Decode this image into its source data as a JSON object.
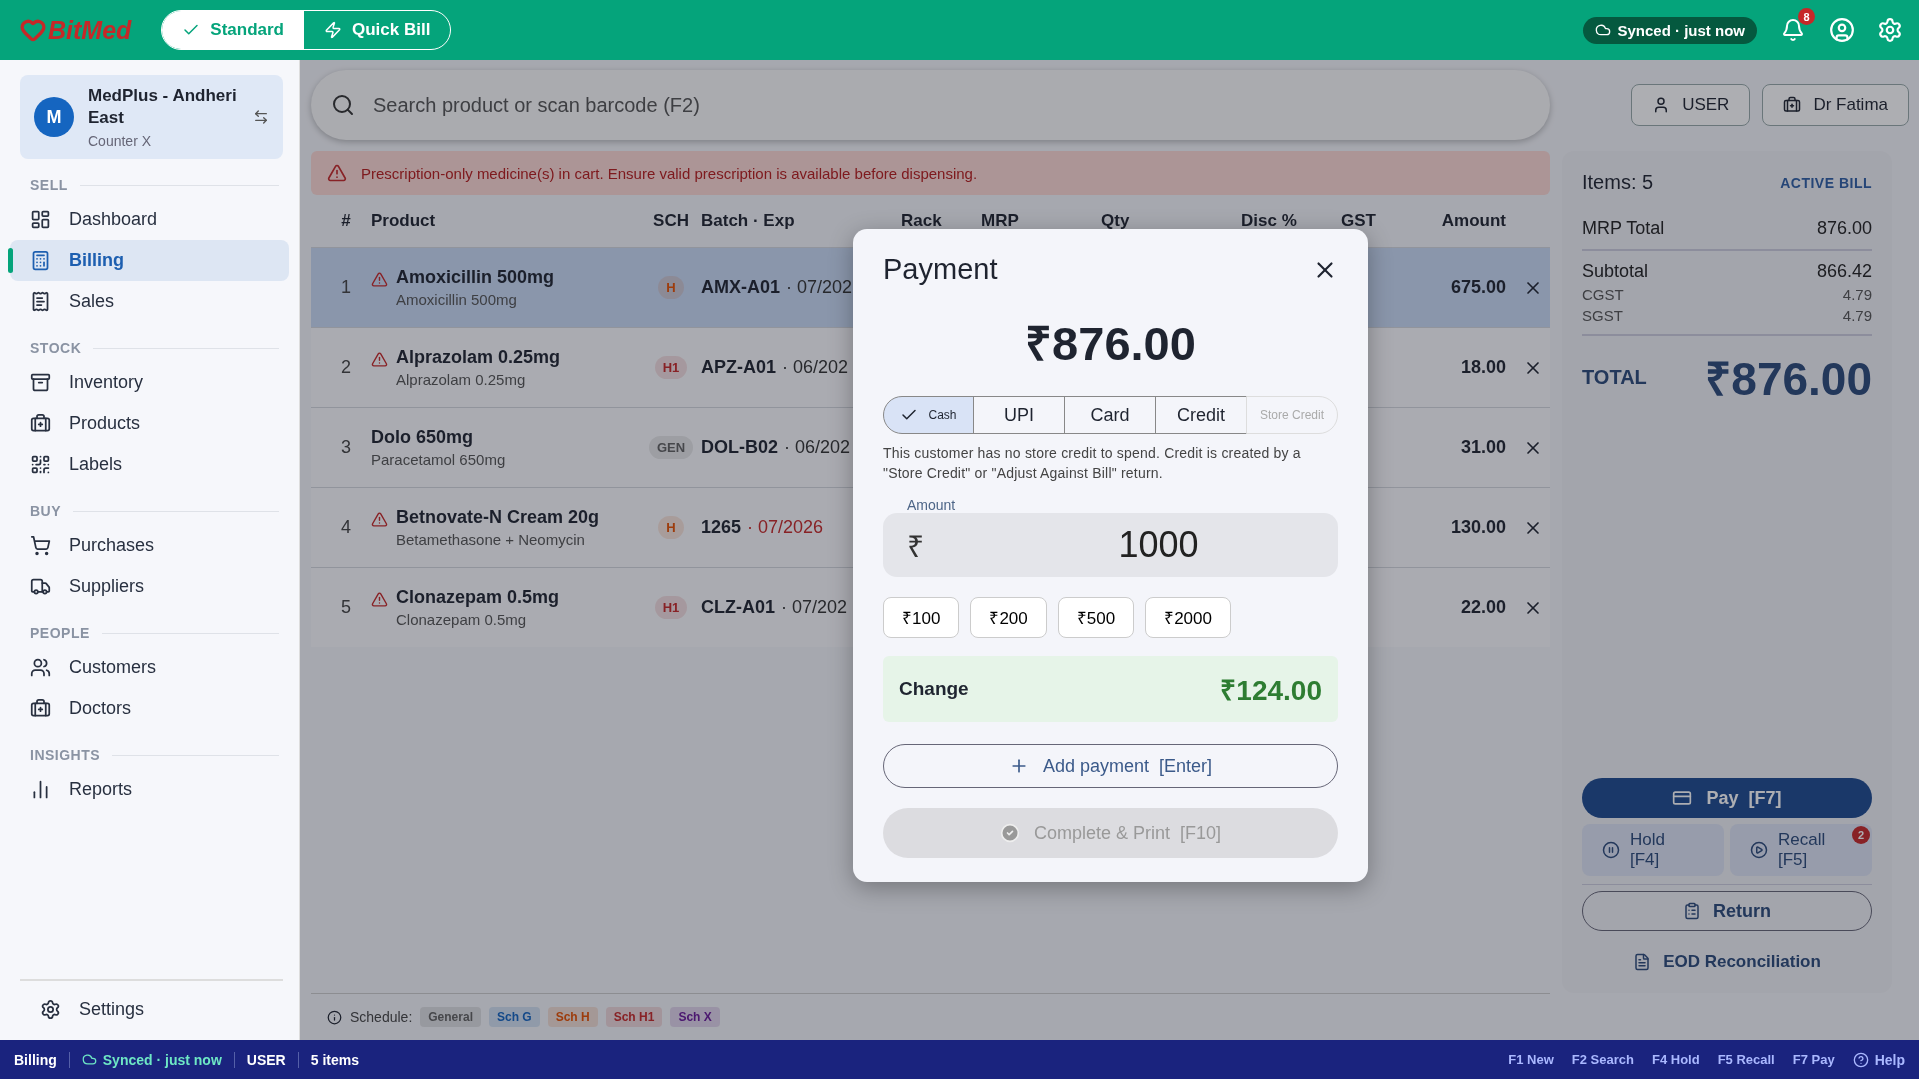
{
  "header": {
    "logo": "BitMed",
    "modes": [
      {
        "label": "Standard",
        "selected": true
      },
      {
        "label": "Quick Bill",
        "selected": false
      }
    ],
    "sync": "Synced · just now",
    "notifications": "8"
  },
  "store": {
    "avatar": "M",
    "name": "MedPlus - Andheri East",
    "counter": "Counter X"
  },
  "sidebar": {
    "sections": [
      {
        "title": "SELL",
        "items": [
          {
            "label": "Dashboard",
            "selected": false
          },
          {
            "label": "Billing",
            "selected": true
          },
          {
            "label": "Sales",
            "selected": false
          }
        ]
      },
      {
        "title": "STOCK",
        "items": [
          {
            "label": "Inventory",
            "selected": false
          },
          {
            "label": "Products",
            "selected": false
          },
          {
            "label": "Labels",
            "selected": false
          }
        ]
      },
      {
        "title": "BUY",
        "items": [
          {
            "label": "Purchases",
            "selected": false
          },
          {
            "label": "Suppliers",
            "selected": false
          }
        ]
      },
      {
        "title": "PEOPLE",
        "items": [
          {
            "label": "Customers",
            "selected": false
          },
          {
            "label": "Doctors",
            "selected": false
          }
        ]
      },
      {
        "title": "INSIGHTS",
        "items": [
          {
            "label": "Reports",
            "selected": false
          }
        ]
      }
    ],
    "footer": "Settings"
  },
  "search": {
    "placeholder": "Search product or scan barcode (F2)"
  },
  "top_buttons": [
    "USER",
    "Dr Fatima"
  ],
  "alert": "Prescription-only medicine(s) in cart. Ensure valid prescription is available before dispensing.",
  "table": {
    "columns": [
      "#",
      "Product",
      "SCH",
      "Batch · Exp",
      "Rack",
      "MRP",
      "Qty",
      "Disc %",
      "GST",
      "Amount"
    ],
    "rows": [
      {
        "index": "1",
        "product": "Amoxicillin 500mg",
        "generic": "Amoxicillin 500mg",
        "warning": true,
        "schedule": {
          "label": "H",
          "kind": "h"
        },
        "batch": "AMX-A01",
        "expiry": "· 07/202",
        "expiry_alert": false,
        "amount": "675.00",
        "selected": true
      },
      {
        "index": "2",
        "product": "Alprazolam 0.25mg",
        "generic": "Alprazolam 0.25mg",
        "warning": true,
        "schedule": {
          "label": "H1",
          "kind": "h1"
        },
        "batch": "APZ-A01",
        "expiry": "· 06/202",
        "expiry_alert": false,
        "amount": "18.00",
        "selected": false
      },
      {
        "index": "3",
        "product": "Dolo 650mg",
        "generic": "Paracetamol 650mg",
        "warning": false,
        "schedule": {
          "label": "GEN",
          "kind": "general"
        },
        "batch": "DOL-B02",
        "expiry": "· 06/202",
        "expiry_alert": false,
        "amount": "31.00",
        "selected": false
      },
      {
        "index": "4",
        "product": "Betnovate-N Cream 20g",
        "generic": "Betamethasone + Neomycin",
        "warning": true,
        "schedule": {
          "label": "H",
          "kind": "h"
        },
        "batch": "1265",
        "expiry": "· 07/2026",
        "expiry_alert": true,
        "amount": "130.00",
        "selected": false
      },
      {
        "index": "5",
        "product": "Clonazepam 0.5mg",
        "generic": "Clonazepam 0.5mg",
        "warning": true,
        "schedule": {
          "label": "H1",
          "kind": "h1"
        },
        "batch": "CLZ-A01",
        "expiry": "· 07/202",
        "expiry_alert": false,
        "amount": "22.00",
        "selected": false
      }
    ]
  },
  "legend": {
    "label": "Schedule:",
    "items": [
      {
        "label": "General",
        "kind": "general"
      },
      {
        "label": "Sch G",
        "kind": "g"
      },
      {
        "label": "Sch H",
        "kind": "h"
      },
      {
        "label": "Sch H1",
        "kind": "h1"
      },
      {
        "label": "Sch X",
        "kind": "x"
      }
    ]
  },
  "summary": {
    "items": "Items: 5",
    "tag": "ACTIVE BILL",
    "groups": [
      [
        {
          "label": "MRP Total",
          "value": "876.00",
          "kind": "main"
        }
      ],
      [
        {
          "label": "Subtotal",
          "value": "866.42",
          "kind": "main"
        },
        {
          "label": "CGST",
          "value": "4.79",
          "kind": "minor"
        },
        {
          "label": "SGST",
          "value": "4.79",
          "kind": "minor"
        }
      ]
    ],
    "total_label": "TOTAL",
    "total": "₹876.00",
    "pay": "Pay  [F7]",
    "hold": [
      "Hold",
      "[F4]"
    ],
    "recall": [
      "Recall",
      "[F5]"
    ],
    "recall_badge": "2",
    "return": "Return",
    "eod": "EOD Reconciliation"
  },
  "payment": {
    "title": "Payment",
    "amount": "₹876.00",
    "methods": [
      {
        "label": "Cash",
        "selected": true,
        "disabled": false
      },
      {
        "label": "UPI",
        "selected": false,
        "disabled": false
      },
      {
        "label": "Card",
        "selected": false,
        "disabled": false
      },
      {
        "label": "Credit",
        "selected": false,
        "disabled": false
      },
      {
        "label": "Store Credit",
        "selected": false,
        "disabled": true
      }
    ],
    "note": "This customer has no store credit to spend. Credit is created by a \"Store Credit\" or \"Adjust Against Bill\" return.",
    "field": {
      "label": "Amount",
      "prefix": "₹",
      "value": "1000"
    },
    "quick": [
      "₹100",
      "₹200",
      "₹500",
      "₹2000"
    ],
    "change": {
      "label": "Change",
      "value": "₹124.00"
    },
    "add": "Add payment  [Enter]",
    "complete": {
      "label": "Complete & Print  [F10]",
      "disabled": true
    }
  },
  "status_bar": {
    "items": [
      {
        "label": "Billing",
        "kind": "page"
      },
      {
        "label": "Synced · just now",
        "kind": "sync"
      },
      {
        "label": "USER",
        "kind": "user"
      },
      {
        "label": "5 items",
        "kind": "count"
      }
    ],
    "shortcuts": [
      "F1 New",
      "F2 Search",
      "F4 Hold",
      "F5 Recall",
      "F7 Pay"
    ],
    "help": "Help"
  }
}
